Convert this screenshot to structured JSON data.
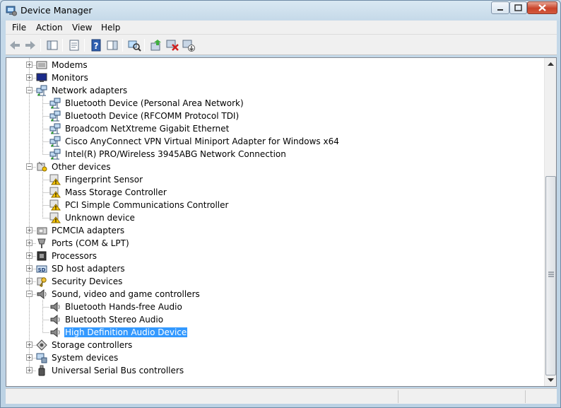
{
  "window": {
    "title": "Device Manager"
  },
  "menu": [
    "File",
    "Action",
    "View",
    "Help"
  ],
  "tree": [
    {
      "label": "Modems",
      "level": 0,
      "state": "collapsed",
      "icon": "modem-icon"
    },
    {
      "label": "Monitors",
      "level": 0,
      "state": "collapsed",
      "icon": "monitor-icon"
    },
    {
      "label": "Network adapters",
      "level": 0,
      "state": "expanded",
      "icon": "network-icon"
    },
    {
      "label": "Bluetooth Device (Personal Area Network)",
      "level": 1,
      "icon": "network-adapter-icon"
    },
    {
      "label": "Bluetooth Device (RFCOMM Protocol TDI)",
      "level": 1,
      "icon": "network-adapter-icon"
    },
    {
      "label": "Broadcom NetXtreme Gigabit Ethernet",
      "level": 1,
      "icon": "network-adapter-icon"
    },
    {
      "label": "Cisco AnyConnect VPN Virtual Miniport Adapter for Windows x64",
      "level": 1,
      "icon": "network-adapter-icon"
    },
    {
      "label": "Intel(R) PRO/Wireless 3945ABG Network Connection",
      "level": 1,
      "icon": "network-adapter-icon"
    },
    {
      "label": "Other devices",
      "level": 0,
      "state": "expanded",
      "icon": "other-devices-icon"
    },
    {
      "label": "Fingerprint Sensor",
      "level": 1,
      "icon": "warning-device-icon"
    },
    {
      "label": "Mass Storage Controller",
      "level": 1,
      "icon": "warning-device-icon"
    },
    {
      "label": "PCI Simple Communications Controller",
      "level": 1,
      "icon": "warning-device-icon"
    },
    {
      "label": "Unknown device",
      "level": 1,
      "icon": "warning-device-icon"
    },
    {
      "label": "PCMCIA adapters",
      "level": 0,
      "state": "collapsed",
      "icon": "pcmcia-icon"
    },
    {
      "label": "Ports (COM & LPT)",
      "level": 0,
      "state": "collapsed",
      "icon": "port-icon"
    },
    {
      "label": "Processors",
      "level": 0,
      "state": "collapsed",
      "icon": "processor-icon"
    },
    {
      "label": "SD host adapters",
      "level": 0,
      "state": "collapsed",
      "icon": "sd-host-icon"
    },
    {
      "label": "Security Devices",
      "level": 0,
      "state": "collapsed",
      "icon": "security-key-icon"
    },
    {
      "label": "Sound, video and game controllers",
      "level": 0,
      "state": "expanded",
      "icon": "speaker-icon"
    },
    {
      "label": "Bluetooth Hands-free Audio",
      "level": 1,
      "icon": "speaker-icon"
    },
    {
      "label": "Bluetooth Stereo Audio",
      "level": 1,
      "icon": "speaker-icon"
    },
    {
      "label": "High Definition Audio Device",
      "level": 1,
      "icon": "speaker-icon",
      "selected": true
    },
    {
      "label": "Storage controllers",
      "level": 0,
      "state": "collapsed",
      "icon": "storage-controller-icon"
    },
    {
      "label": "System devices",
      "level": 0,
      "state": "collapsed",
      "icon": "system-devices-icon"
    },
    {
      "label": "Universal Serial Bus controllers",
      "level": 0,
      "state": "collapsed",
      "icon": "usb-icon"
    }
  ],
  "colors": {
    "selection": "#3399ff",
    "warning": "#f5c400"
  }
}
